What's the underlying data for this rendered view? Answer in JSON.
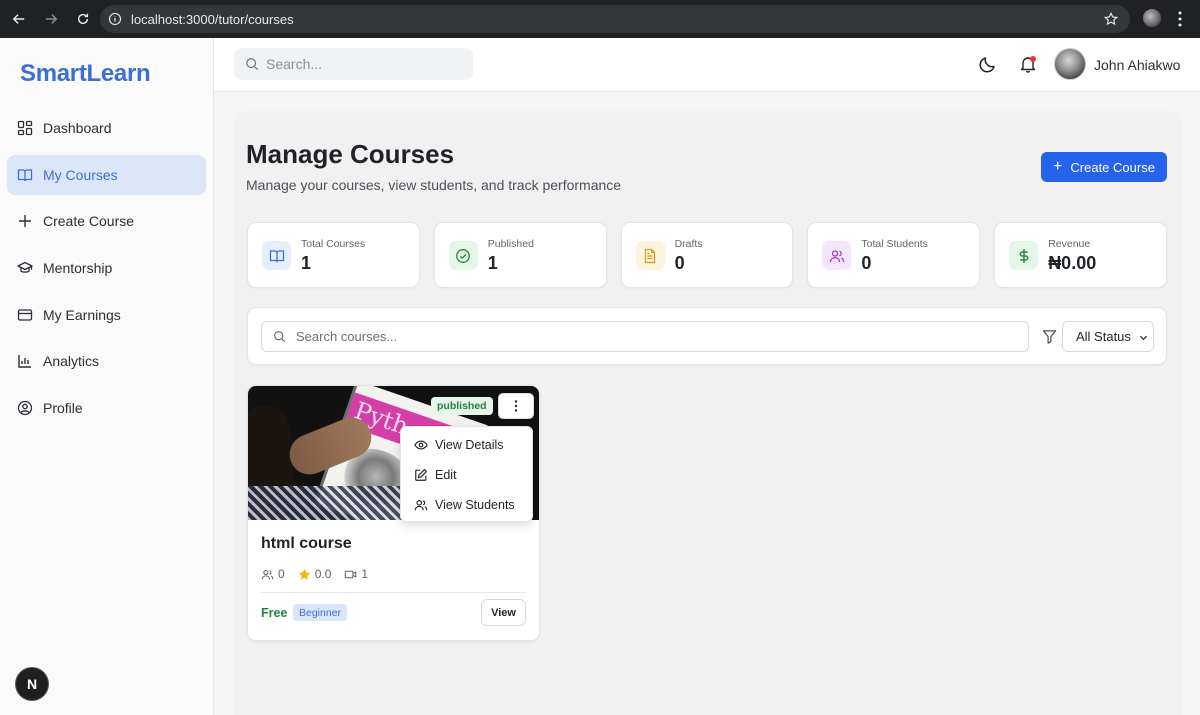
{
  "browser": {
    "url": "localhost:3000/tutor/courses"
  },
  "sidebar": {
    "brand": "SmartLearn",
    "items": [
      {
        "label": "Dashboard",
        "icon": "dashboard-icon"
      },
      {
        "label": "My Courses",
        "icon": "book-icon",
        "active": true
      },
      {
        "label": "Create Course",
        "icon": "plus-icon"
      },
      {
        "label": "Mentorship",
        "icon": "graduation-cap-icon"
      },
      {
        "label": "My Earnings",
        "icon": "credit-card-icon"
      },
      {
        "label": "Analytics",
        "icon": "bar-chart-icon"
      },
      {
        "label": "Profile",
        "icon": "user-circle-icon"
      }
    ],
    "dev_badge": "N"
  },
  "header": {
    "search_placeholder": "Search...",
    "user_name": "John Ahiakwo"
  },
  "page": {
    "title": "Manage Courses",
    "subtitle": "Manage your courses, view students, and track performance",
    "create_button": "Create Course"
  },
  "stats": [
    {
      "label": "Total Courses",
      "value": "1",
      "icon": "book-icon",
      "color": "#3b6fd4"
    },
    {
      "label": "Published",
      "value": "1",
      "icon": "check-circle-icon",
      "color": "#23843f"
    },
    {
      "label": "Drafts",
      "value": "0",
      "icon": "file-text-icon",
      "color": "#d4a017"
    },
    {
      "label": "Total Students",
      "value": "0",
      "icon": "users-icon",
      "color": "#a23bd4"
    },
    {
      "label": "Revenue",
      "value": "₦0.00",
      "icon": "dollar-icon",
      "color": "#23843f"
    }
  ],
  "filters": {
    "search_placeholder": "Search courses...",
    "status_selected": "All Status"
  },
  "course": {
    "status": "published",
    "title": "html course",
    "students": "0",
    "rating": "0.0",
    "videos": "1",
    "price": "Free",
    "level": "Beginner",
    "view_button": "View",
    "menu": [
      "View Details",
      "Edit",
      "View Students"
    ]
  },
  "colors": {
    "accent": "#2563eb",
    "brand": "#3b6fd4",
    "success": "#23843f"
  }
}
